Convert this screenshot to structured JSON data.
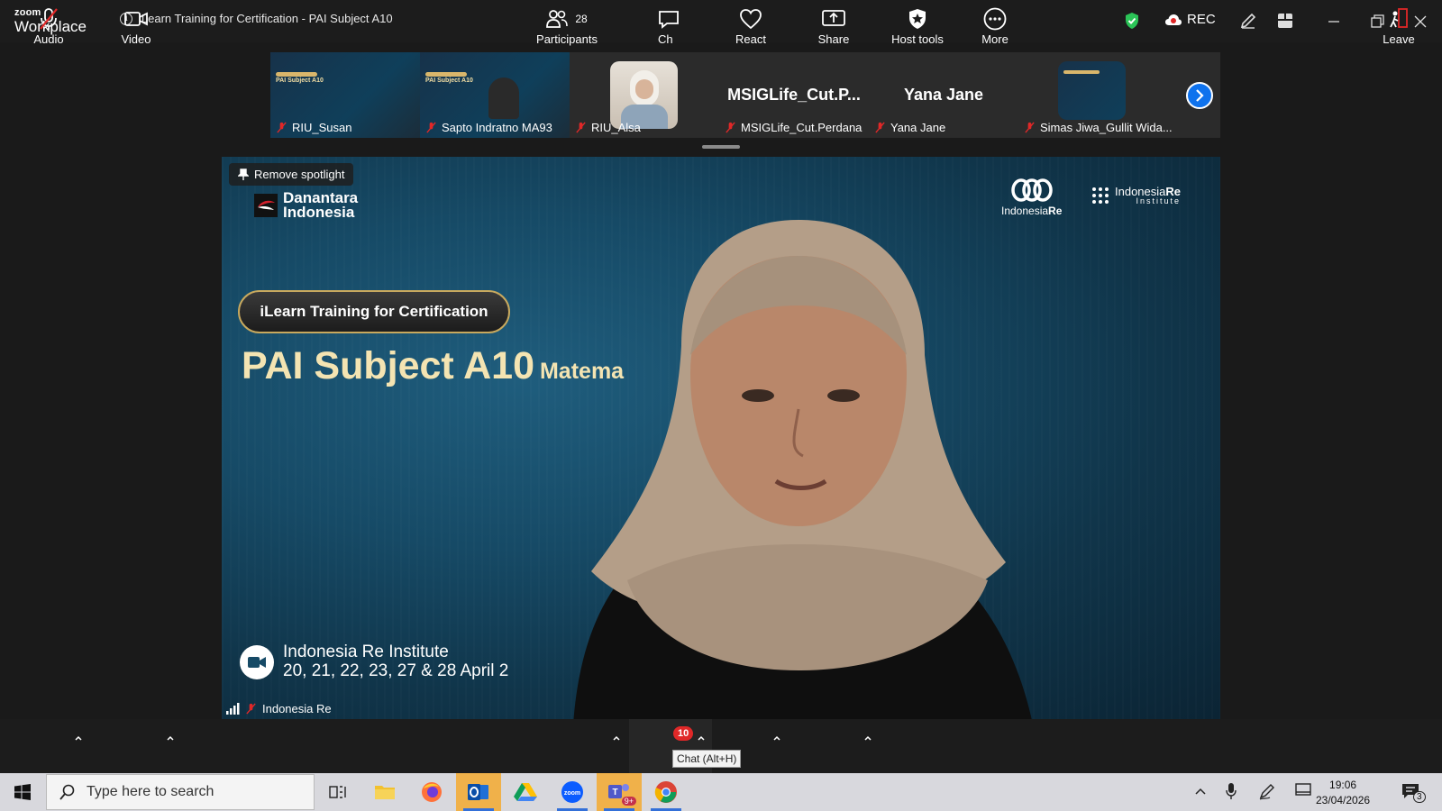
{
  "app": {
    "brand_top": "zoom",
    "brand_bottom": "Workplace",
    "meeting_title": "iLearn Training for Certification - PAI Subject A10",
    "rec_label": "REC"
  },
  "participants_strip": [
    {
      "name": "RIU_Susan",
      "type": "slide"
    },
    {
      "name": "Sapto Indratno MA93",
      "type": "slide"
    },
    {
      "name": "RIU_Alsa",
      "type": "photo"
    },
    {
      "name": "MSIGLife_Cut.Perdana",
      "display": "MSIGLife_Cut.P...",
      "type": "name"
    },
    {
      "name": "Yana Jane",
      "display": "Yana Jane",
      "type": "name"
    },
    {
      "name": "Simas Jiwa_Gullit Wida...",
      "type": "slide"
    }
  ],
  "main_video": {
    "spotlight_button": "Remove spotlight",
    "slide_logo_left": [
      "Danantara",
      "Indonesia"
    ],
    "slide_logo_right1": [
      "Indonesia",
      "Re"
    ],
    "slide_logo_right2": [
      "Indonesia",
      "Re",
      "Institute"
    ],
    "slide_pill": "iLearn Training for Certification",
    "slide_headline": "PAI Subject A10",
    "slide_headline_sub": "Matema",
    "slide_institute": "Indonesia Re Institute",
    "slide_dates": "20, 21, 22, 23, 27 & 28 April 2",
    "speaker_name": "Indonesia Re"
  },
  "toolbar": {
    "audio": "Audio",
    "video": "Video",
    "participants": "Participants",
    "participants_count": "28",
    "chat": "Ch",
    "chat_badge": "10",
    "chat_tooltip": "Chat (Alt+H)",
    "react": "React",
    "share": "Share",
    "host_tools": "Host tools",
    "more": "More",
    "leave": "Leave"
  },
  "taskbar": {
    "search_placeholder": "Type here to search",
    "time": "19:06",
    "date": "23/04/2026",
    "notification_count": "3",
    "teams_badge": "9+"
  },
  "colors": {
    "accent": "#0e72ed",
    "shield": "#2bc457",
    "badge": "#e02828",
    "slide_gold": "#f4e4b2"
  }
}
